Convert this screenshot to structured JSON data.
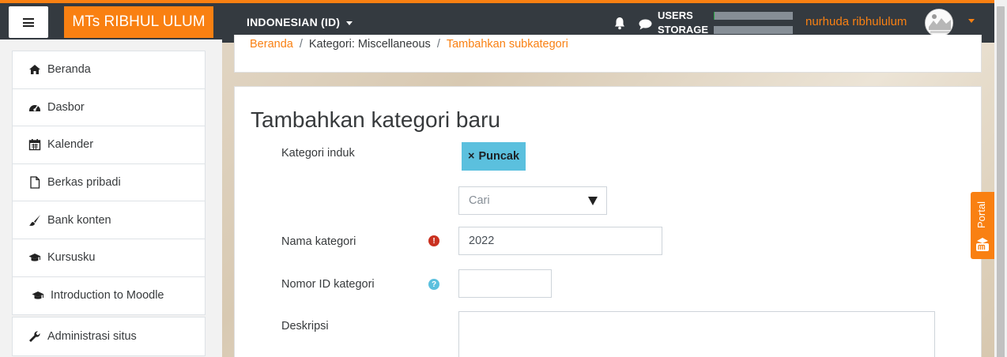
{
  "navbar": {
    "brand": "MTs RIBHUL ULUM",
    "language": "INDONESIAN (ID)",
    "quota_users_label": "USERS",
    "quota_storage_label": "STORAGE",
    "quota_users_fraction": 0.01,
    "quota_storage_fraction": 0.0,
    "username": "nurhuda ribhululum"
  },
  "sidebar": {
    "items": [
      {
        "label": "Beranda",
        "icon": "home-icon"
      },
      {
        "label": "Dasbor",
        "icon": "dashboard-icon"
      },
      {
        "label": "Kalender",
        "icon": "calendar-icon"
      },
      {
        "label": "Berkas pribadi",
        "icon": "file-icon"
      },
      {
        "label": "Bank konten",
        "icon": "paintbrush-icon"
      },
      {
        "label": "Kursusku",
        "icon": "graduation-cap-icon"
      },
      {
        "label": "Introduction to Moodle",
        "icon": "graduation-cap-icon"
      }
    ],
    "admin": {
      "label": "Administrasi situs",
      "icon": "wrench-icon"
    }
  },
  "breadcrumb": {
    "home": "Beranda",
    "category": "Kategori: Miscellaneous",
    "current": "Tambahkan subkategori"
  },
  "form": {
    "title": "Tambahkan kategori baru",
    "parent_label": "Kategori induk",
    "parent_tag": "Puncak",
    "tag_remove": "×",
    "search_placeholder": "Cari",
    "name_label": "Nama kategori",
    "name_value": "2022",
    "id_label": "Nomor ID kategori",
    "id_value": "",
    "desc_label": "Deskripsi",
    "required_icon": "!",
    "help_icon": "?"
  },
  "portal": {
    "label": "Portal"
  },
  "colors": {
    "accent": "#f98012",
    "navbar": "#343a40",
    "tag": "#5bc0de",
    "required": "#ca3120"
  }
}
